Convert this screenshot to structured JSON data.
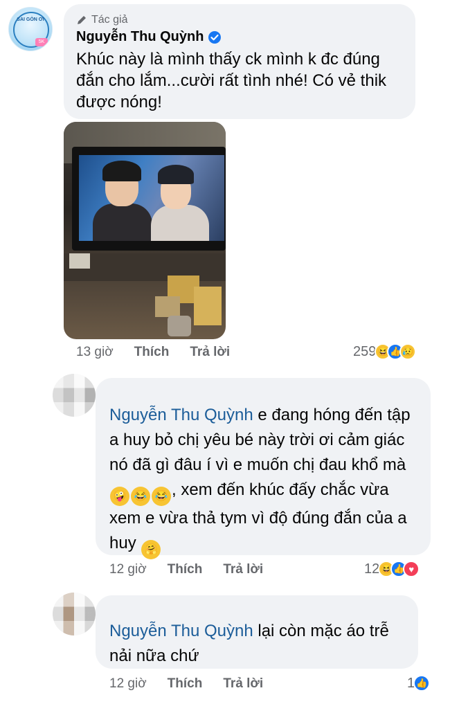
{
  "post": {
    "author_tag": "Tác giả",
    "author_name": "Nguyễn Thu Quỳnh",
    "text": "Khúc này là mình thấy ck mình k đc đúng đắn cho lắm...cười rất tình nhé! Có vẻ thik được nóng!",
    "time": "13 giờ",
    "like_label": "Thích",
    "reply_label": "Trả lời",
    "reaction_count": "259",
    "reactions": [
      "haha-icon",
      "like-icon",
      "sad-icon"
    ]
  },
  "reply1": {
    "mention": "Nguyễn Thu Quỳnh",
    "text_before_emoji": " e đang hóng đến tập a huy bỏ chị yêu bé này trời ơi cảm giác nó đã gì đâu í vì e muốn chị đau khổ mà",
    "text_after_emoji": ", xem đến khúc đấy chắc vừa xem e vừa thả tym vì độ đúng đắn của a huy ",
    "emojis": [
      "zany-face-icon",
      "tears-joy-icon",
      "tears-joy-icon"
    ],
    "end_emoji": "hugging-face-icon",
    "time": "12 giờ",
    "like_label": "Thích",
    "reply_label": "Trả lời",
    "reaction_count": "12",
    "reactions": [
      "haha-icon",
      "like-icon",
      "love-icon"
    ]
  },
  "reply2": {
    "mention": "Nguyễn Thu Quỳnh",
    "text": " lại còn mặc áo trễ nải nữa chứ",
    "time": "12 giờ",
    "like_label": "Thích",
    "reply_label": "Trả lời",
    "reaction_count": "1",
    "reactions": [
      "like-icon"
    ]
  },
  "colors": {
    "bubble": "#f0f2f5",
    "mention": "#1c5d99",
    "meta": "#65676b",
    "like": "#1877f2",
    "verified": "#1877f2"
  }
}
